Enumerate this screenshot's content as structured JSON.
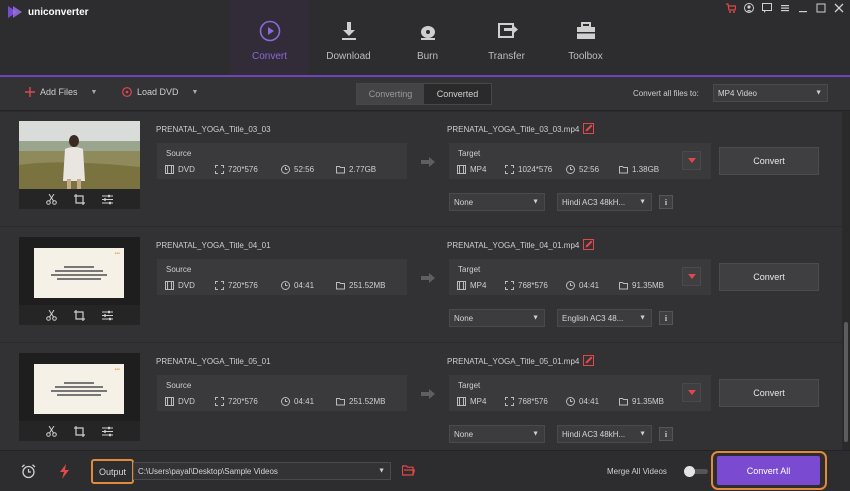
{
  "app": {
    "name": "uniconverter"
  },
  "nav": [
    {
      "label": "Convert",
      "icon": "play-circle-icon",
      "active": true
    },
    {
      "label": "Download",
      "icon": "download-icon"
    },
    {
      "label": "Burn",
      "icon": "disc-icon"
    },
    {
      "label": "Transfer",
      "icon": "transfer-icon"
    },
    {
      "label": "Toolbox",
      "icon": "toolbox-icon"
    }
  ],
  "toolbar": {
    "add_files": "Add Files",
    "load_dvd": "Load DVD",
    "tab_converting": "Converting",
    "tab_converted": "Converted",
    "convert_all_to_label": "Convert all files to:",
    "convert_all_to_value": "MP4 Video"
  },
  "items": [
    {
      "title": "PRENATAL_YOGA_Title_03_03",
      "source": {
        "label": "Source",
        "format": "DVD",
        "resolution": "720*576",
        "duration": "52:56",
        "size": "2.77GB"
      },
      "target": {
        "name": "PRENATAL_YOGA_Title_03_03.mp4",
        "label": "Target",
        "format": "MP4",
        "resolution": "1024*576",
        "duration": "52:56",
        "size": "1.38GB"
      },
      "subtitle": "None",
      "audio": "Hindi AC3 48kH...",
      "convert_label": "Convert",
      "thumb": "photo"
    },
    {
      "title": "PRENATAL_YOGA_Title_04_01",
      "source": {
        "label": "Source",
        "format": "DVD",
        "resolution": "720*576",
        "duration": "04:41",
        "size": "251.52MB"
      },
      "target": {
        "name": "PRENATAL_YOGA_Title_04_01.mp4",
        "label": "Target",
        "format": "MP4",
        "resolution": "768*576",
        "duration": "04:41",
        "size": "91.35MB"
      },
      "subtitle": "None",
      "audio": "English AC3 48...",
      "convert_label": "Convert",
      "thumb": "slide"
    },
    {
      "title": "PRENATAL_YOGA_Title_05_01",
      "source": {
        "label": "Source",
        "format": "DVD",
        "resolution": "720*576",
        "duration": "04:41",
        "size": "251.52MB"
      },
      "target": {
        "name": "PRENATAL_YOGA_Title_05_01.mp4",
        "label": "Target",
        "format": "MP4",
        "resolution": "768*576",
        "duration": "04:41",
        "size": "91.35MB"
      },
      "subtitle": "None",
      "audio": "Hindi AC3 48kH...",
      "convert_label": "Convert",
      "thumb": "slide"
    }
  ],
  "bottom": {
    "output_label": "Output",
    "output_path": "C:\\Users\\payal\\Desktop\\Sample Videos",
    "merge_label": "Merge All Videos",
    "convert_all": "Convert All"
  },
  "colors": {
    "accent": "#7a4bd0",
    "highlight": "#e08a3b",
    "edit": "#e0484c"
  }
}
